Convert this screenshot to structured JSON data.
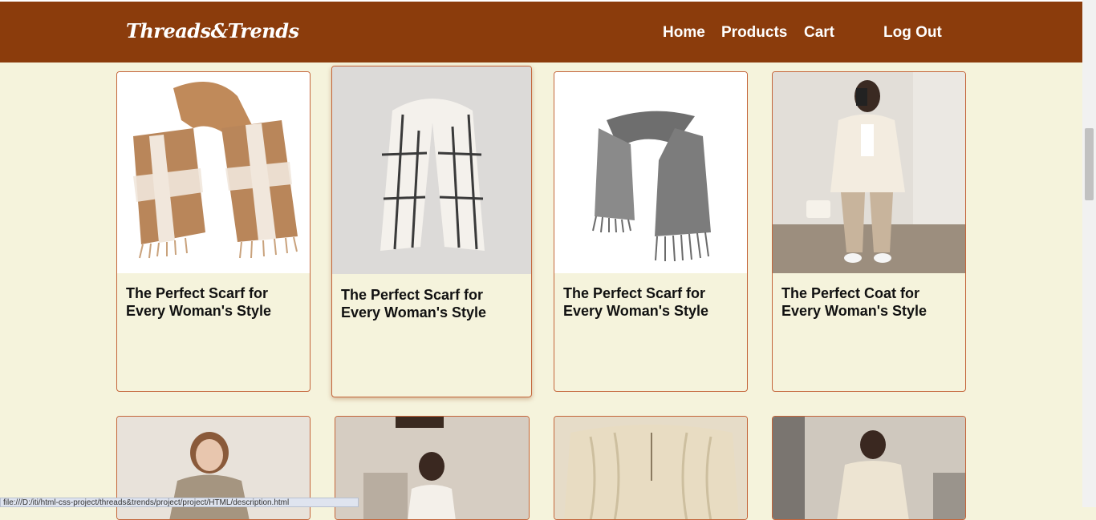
{
  "brand": {
    "name": "Threads&Trends"
  },
  "nav": {
    "home": "Home",
    "products": "Products",
    "cart": "Cart",
    "logout": "Log Out"
  },
  "colors": {
    "navbar": "#8b3c0c",
    "background": "#f5f3dc",
    "card_border": "#c4653a"
  },
  "products": [
    {
      "title": "The Perfect Scarf for Every Woman's Style",
      "image": "beige-plaid-scarf"
    },
    {
      "title": "The Perfect Scarf for Every Woman's Style",
      "image": "white-grid-scarf"
    },
    {
      "title": "The Perfect Scarf for Every Woman's Style",
      "image": "grey-knit-scarf"
    },
    {
      "title": "The Perfect Coat for Every Woman's Style",
      "image": "cream-blazer-outfit"
    },
    {
      "title": "",
      "image": "beige-knit-sweater"
    },
    {
      "title": "",
      "image": "white-off-shoulder-top"
    },
    {
      "title": "",
      "image": "cable-knit-sweater"
    },
    {
      "title": "",
      "image": "cream-coat-outfit"
    }
  ],
  "status_bar": {
    "url": "file:///D:/iti/html-css-project/threads&trends/project/project/HTML/description.html"
  }
}
